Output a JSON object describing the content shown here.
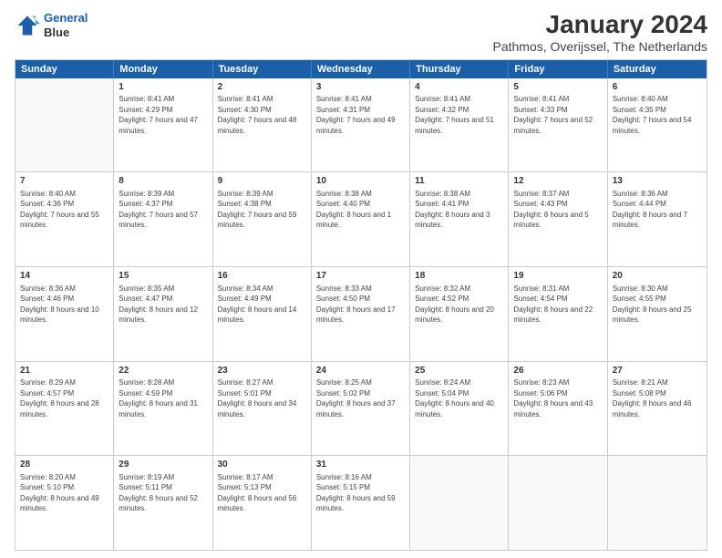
{
  "logo": {
    "line1": "General",
    "line2": "Blue"
  },
  "title": "January 2024",
  "subtitle": "Pathmos, Overijssel, The Netherlands",
  "header_days": [
    "Sunday",
    "Monday",
    "Tuesday",
    "Wednesday",
    "Thursday",
    "Friday",
    "Saturday"
  ],
  "weeks": [
    [
      {
        "day": "",
        "sunrise": "",
        "sunset": "",
        "daylight": ""
      },
      {
        "day": "1",
        "sunrise": "Sunrise: 8:41 AM",
        "sunset": "Sunset: 4:29 PM",
        "daylight": "Daylight: 7 hours and 47 minutes."
      },
      {
        "day": "2",
        "sunrise": "Sunrise: 8:41 AM",
        "sunset": "Sunset: 4:30 PM",
        "daylight": "Daylight: 7 hours and 48 minutes."
      },
      {
        "day": "3",
        "sunrise": "Sunrise: 8:41 AM",
        "sunset": "Sunset: 4:31 PM",
        "daylight": "Daylight: 7 hours and 49 minutes."
      },
      {
        "day": "4",
        "sunrise": "Sunrise: 8:41 AM",
        "sunset": "Sunset: 4:32 PM",
        "daylight": "Daylight: 7 hours and 51 minutes."
      },
      {
        "day": "5",
        "sunrise": "Sunrise: 8:41 AM",
        "sunset": "Sunset: 4:33 PM",
        "daylight": "Daylight: 7 hours and 52 minutes."
      },
      {
        "day": "6",
        "sunrise": "Sunrise: 8:40 AM",
        "sunset": "Sunset: 4:35 PM",
        "daylight": "Daylight: 7 hours and 54 minutes."
      }
    ],
    [
      {
        "day": "7",
        "sunrise": "Sunrise: 8:40 AM",
        "sunset": "Sunset: 4:36 PM",
        "daylight": "Daylight: 7 hours and 55 minutes."
      },
      {
        "day": "8",
        "sunrise": "Sunrise: 8:39 AM",
        "sunset": "Sunset: 4:37 PM",
        "daylight": "Daylight: 7 hours and 57 minutes."
      },
      {
        "day": "9",
        "sunrise": "Sunrise: 8:39 AM",
        "sunset": "Sunset: 4:38 PM",
        "daylight": "Daylight: 7 hours and 59 minutes."
      },
      {
        "day": "10",
        "sunrise": "Sunrise: 8:38 AM",
        "sunset": "Sunset: 4:40 PM",
        "daylight": "Daylight: 8 hours and 1 minute."
      },
      {
        "day": "11",
        "sunrise": "Sunrise: 8:38 AM",
        "sunset": "Sunset: 4:41 PM",
        "daylight": "Daylight: 8 hours and 3 minutes."
      },
      {
        "day": "12",
        "sunrise": "Sunrise: 8:37 AM",
        "sunset": "Sunset: 4:43 PM",
        "daylight": "Daylight: 8 hours and 5 minutes."
      },
      {
        "day": "13",
        "sunrise": "Sunrise: 8:36 AM",
        "sunset": "Sunset: 4:44 PM",
        "daylight": "Daylight: 8 hours and 7 minutes."
      }
    ],
    [
      {
        "day": "14",
        "sunrise": "Sunrise: 8:36 AM",
        "sunset": "Sunset: 4:46 PM",
        "daylight": "Daylight: 8 hours and 10 minutes."
      },
      {
        "day": "15",
        "sunrise": "Sunrise: 8:35 AM",
        "sunset": "Sunset: 4:47 PM",
        "daylight": "Daylight: 8 hours and 12 minutes."
      },
      {
        "day": "16",
        "sunrise": "Sunrise: 8:34 AM",
        "sunset": "Sunset: 4:49 PM",
        "daylight": "Daylight: 8 hours and 14 minutes."
      },
      {
        "day": "17",
        "sunrise": "Sunrise: 8:33 AM",
        "sunset": "Sunset: 4:50 PM",
        "daylight": "Daylight: 8 hours and 17 minutes."
      },
      {
        "day": "18",
        "sunrise": "Sunrise: 8:32 AM",
        "sunset": "Sunset: 4:52 PM",
        "daylight": "Daylight: 8 hours and 20 minutes."
      },
      {
        "day": "19",
        "sunrise": "Sunrise: 8:31 AM",
        "sunset": "Sunset: 4:54 PM",
        "daylight": "Daylight: 8 hours and 22 minutes."
      },
      {
        "day": "20",
        "sunrise": "Sunrise: 8:30 AM",
        "sunset": "Sunset: 4:55 PM",
        "daylight": "Daylight: 8 hours and 25 minutes."
      }
    ],
    [
      {
        "day": "21",
        "sunrise": "Sunrise: 8:29 AM",
        "sunset": "Sunset: 4:57 PM",
        "daylight": "Daylight: 8 hours and 28 minutes."
      },
      {
        "day": "22",
        "sunrise": "Sunrise: 8:28 AM",
        "sunset": "Sunset: 4:59 PM",
        "daylight": "Daylight: 8 hours and 31 minutes."
      },
      {
        "day": "23",
        "sunrise": "Sunrise: 8:27 AM",
        "sunset": "Sunset: 5:01 PM",
        "daylight": "Daylight: 8 hours and 34 minutes."
      },
      {
        "day": "24",
        "sunrise": "Sunrise: 8:25 AM",
        "sunset": "Sunset: 5:02 PM",
        "daylight": "Daylight: 8 hours and 37 minutes."
      },
      {
        "day": "25",
        "sunrise": "Sunrise: 8:24 AM",
        "sunset": "Sunset: 5:04 PM",
        "daylight": "Daylight: 8 hours and 40 minutes."
      },
      {
        "day": "26",
        "sunrise": "Sunrise: 8:23 AM",
        "sunset": "Sunset: 5:06 PM",
        "daylight": "Daylight: 8 hours and 43 minutes."
      },
      {
        "day": "27",
        "sunrise": "Sunrise: 8:21 AM",
        "sunset": "Sunset: 5:08 PM",
        "daylight": "Daylight: 8 hours and 46 minutes."
      }
    ],
    [
      {
        "day": "28",
        "sunrise": "Sunrise: 8:20 AM",
        "sunset": "Sunset: 5:10 PM",
        "daylight": "Daylight: 8 hours and 49 minutes."
      },
      {
        "day": "29",
        "sunrise": "Sunrise: 8:19 AM",
        "sunset": "Sunset: 5:11 PM",
        "daylight": "Daylight: 8 hours and 52 minutes."
      },
      {
        "day": "30",
        "sunrise": "Sunrise: 8:17 AM",
        "sunset": "Sunset: 5:13 PM",
        "daylight": "Daylight: 8 hours and 56 minutes."
      },
      {
        "day": "31",
        "sunrise": "Sunrise: 8:16 AM",
        "sunset": "Sunset: 5:15 PM",
        "daylight": "Daylight: 8 hours and 59 minutes."
      },
      {
        "day": "",
        "sunrise": "",
        "sunset": "",
        "daylight": ""
      },
      {
        "day": "",
        "sunrise": "",
        "sunset": "",
        "daylight": ""
      },
      {
        "day": "",
        "sunrise": "",
        "sunset": "",
        "daylight": ""
      }
    ]
  ]
}
